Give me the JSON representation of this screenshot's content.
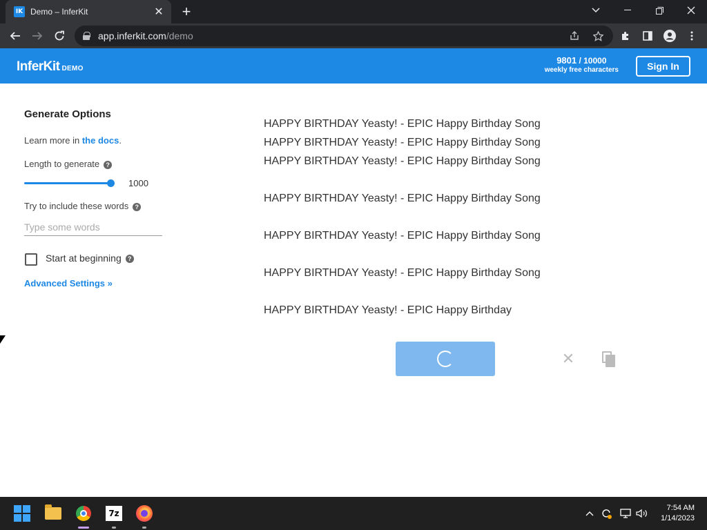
{
  "browser": {
    "tab_title": "Demo – InferKit",
    "favicon_text": "IK",
    "new_tab_symbol": "+",
    "url_host": "app.inferkit.com",
    "url_path": "/demo"
  },
  "header": {
    "logo": "InferKit",
    "logo_badge": "DEMO",
    "chars_used": "9801",
    "chars_total": "/ 10000",
    "chars_label": "weekly free characters",
    "signin_label": "Sign In",
    "brand_color": "#1e88e5"
  },
  "options": {
    "title": "Generate Options",
    "learn_prefix": "Learn more in",
    "learn_link": "the docs",
    "learn_suffix": ".",
    "length_label": "Length to generate",
    "length_value": "1000",
    "length_fraction": 1.0,
    "words_label": "Try to include these words",
    "words_placeholder": "Type some words",
    "words_value": "",
    "start_label": "Start at beginning",
    "start_checked": false,
    "advanced_label": "Advanced Settings »",
    "help_symbol": "?"
  },
  "output": {
    "lines": [
      "HAPPY BIRTHDAY Yeasty! - EPIC Happy Birthday Song",
      "HAPPY BIRTHDAY Yeasty! - EPIC Happy Birthday Song",
      "HAPPY BIRTHDAY Yeasty! - EPIC Happy Birthday Song",
      "",
      "HAPPY BIRTHDAY Yeasty! - EPIC Happy Birthday Song",
      "",
      "HAPPY BIRTHDAY Yeasty! - EPIC Happy Birthday Song",
      "",
      "HAPPY BIRTHDAY Yeasty! - EPIC Happy Birthday Song",
      "",
      "HAPPY BIRTHDAY Yeasty! - EPIC Happy Birthday"
    ],
    "clear_symbol": "✕"
  },
  "taskbar": {
    "apps": [
      "start-icon",
      "file-explorer-icon",
      "chrome-icon",
      "7zip-icon",
      "firefox-icon"
    ],
    "sevenzip_text": "7z",
    "tray_up_symbol": "^",
    "time": "7:54 AM",
    "date": "1/14/2023"
  }
}
